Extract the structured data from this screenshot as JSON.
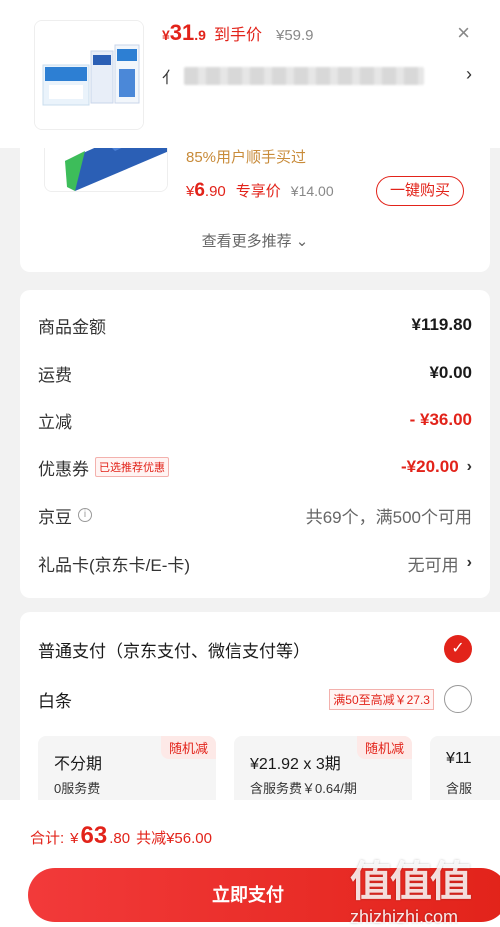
{
  "header": {
    "currency": "¥",
    "price_int": "31",
    "price_dec": ".9",
    "arrive_label": "到手价",
    "original_price": "¥59.9",
    "close": "×",
    "addr_prefix": "亻"
  },
  "recommend": {
    "subtitle": "85%用户顺手买过",
    "currency": "¥",
    "price_int": "6",
    "price_dec": ".90",
    "tag": "专享价",
    "old_price": "¥14.00",
    "buy_button": "一键购买",
    "more": "查看更多推荐"
  },
  "cost": {
    "rows": [
      {
        "label": "商品金额",
        "value": "¥119.80"
      },
      {
        "label": "运费",
        "value": "¥0.00"
      },
      {
        "label": "立减",
        "value": "- ¥36.00"
      },
      {
        "label": "优惠券",
        "badge": "已选推荐优惠",
        "value": "-¥20.00"
      },
      {
        "label": "京豆",
        "value": "共69个，满500个可用"
      },
      {
        "label": "礼品卡(京东卡/E-卡)",
        "value": "无可用"
      }
    ]
  },
  "payment": {
    "method1": "普通支付（京东支付、微信支付等）",
    "method2": "白条",
    "method2_promo": "满50至高减￥27.3",
    "options": [
      {
        "title": "不分期",
        "sub": "0服务费",
        "corner": "随机减"
      },
      {
        "title": "¥21.92 x 3期",
        "sub": "含服务费￥0.64/期",
        "corner": "随机减"
      },
      {
        "title": "¥11",
        "sub": "含服"
      }
    ]
  },
  "bottom": {
    "total_label": "合计:",
    "currency": "¥",
    "total_int": "63",
    "total_dec": ".80",
    "saved": "共减¥56.00",
    "pay_button": "立即支付"
  },
  "watermark": {
    "glyphs": "值值值",
    "text": "zhizhizhi.com"
  }
}
